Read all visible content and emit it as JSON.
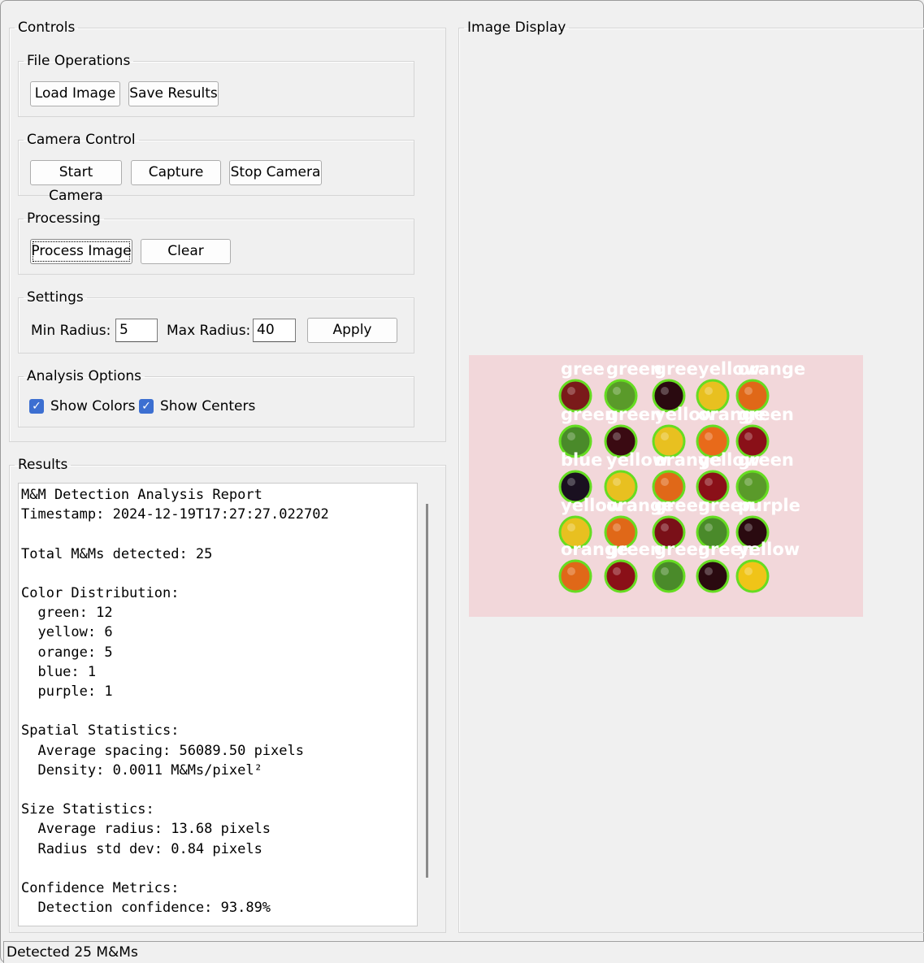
{
  "controls": {
    "title": "Controls",
    "file_ops": {
      "title": "File Operations",
      "load_label": "Load Image",
      "save_label": "Save Results"
    },
    "camera": {
      "title": "Camera Control",
      "start_label": "Start Camera",
      "capture_label": "Capture",
      "stop_label": "Stop Camera"
    },
    "processing": {
      "title": "Processing",
      "process_label": "Process Image",
      "clear_label": "Clear"
    },
    "settings": {
      "title": "Settings",
      "min_label": "Min Radius:",
      "min_value": "5",
      "max_label": "Max Radius:",
      "max_value": "40",
      "apply_label": "Apply"
    },
    "analysis": {
      "title": "Analysis Options",
      "show_colors_label": "Show Colors",
      "show_colors_checked": true,
      "show_centers_label": "Show Centers",
      "show_centers_checked": true
    }
  },
  "results": {
    "title": "Results",
    "lines": [
      "M&M Detection Analysis Report",
      "Timestamp: 2024-12-19T17:27:27.022702",
      "",
      "Total M&Ms detected: 25",
      "",
      "Color Distribution:",
      "  green: 12",
      "  yellow: 6",
      "  orange: 5",
      "  blue: 1",
      "  purple: 1",
      "",
      "Spatial Statistics:",
      "  Average spacing: 56089.50 pixels",
      "  Density: 0.0011 M&Ms/pixel²",
      "",
      "Size Statistics:",
      "  Average radius: 13.68 pixels",
      "  Radius std dev: 0.84 pixels",
      "",
      "Confidence Metrics:",
      "  Detection confidence: 93.89%"
    ]
  },
  "image_display": {
    "title": "Image Display",
    "background_color": "#f2d7da",
    "circle_outline_color": "#66dd22",
    "rows": [
      {
        "labels": [
          "gree",
          "green",
          "gree",
          "yellow",
          "orange"
        ],
        "fills": [
          "#7a1a1a",
          "#5a9a2a",
          "#2a0a10",
          "#e8c020",
          "#e06818"
        ]
      },
      {
        "labels": [
          "green",
          "green",
          "yellow",
          "orange",
          "green"
        ],
        "fills": [
          "#4a8a2a",
          "#3a0a12",
          "#e8c020",
          "#e86a1a",
          "#8a1018"
        ]
      },
      {
        "labels": [
          "blue",
          "yellow",
          "orange",
          "yellow",
          "green"
        ],
        "fills": [
          "#1a1020",
          "#e8c020",
          "#e06818",
          "#8a1018",
          "#5a9a2a"
        ]
      },
      {
        "labels": [
          "yellow",
          "orange",
          "green",
          "green",
          "purple"
        ],
        "fills": [
          "#e8c020",
          "#e06818",
          "#7a1018",
          "#4a8a2a",
          "#2a0a10"
        ]
      },
      {
        "labels": [
          "orange",
          "green",
          "green",
          "green",
          "yellow"
        ],
        "fills": [
          "#e06818",
          "#8a1018",
          "#4a8a2a",
          "#2a0a10",
          "#f0c418"
        ]
      }
    ]
  },
  "status": {
    "text": "Detected 25 M&Ms"
  },
  "icons": {
    "checkmark": "checkmark-icon"
  }
}
